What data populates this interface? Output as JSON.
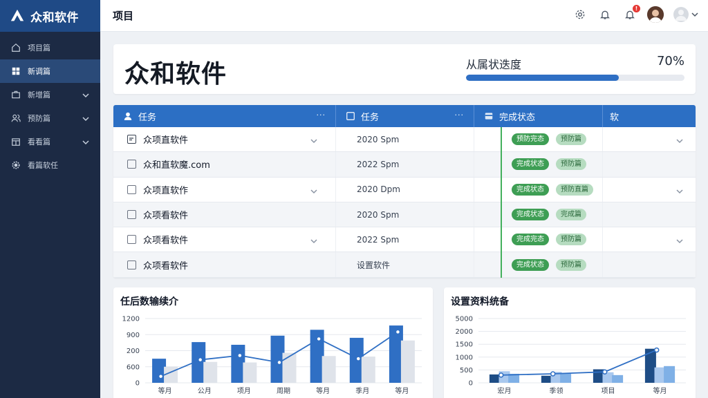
{
  "app": {
    "name": "众和软件"
  },
  "sidebar": {
    "items": [
      {
        "label": "项目篇",
        "icon": "home-icon",
        "active": false,
        "chevron": false
      },
      {
        "label": "新调篇",
        "icon": "grid-icon",
        "active": true,
        "chevron": false
      },
      {
        "label": "新增篇",
        "icon": "briefcase-icon",
        "active": false,
        "chevron": true
      },
      {
        "label": "预防篇",
        "icon": "users-icon",
        "active": false,
        "chevron": true
      },
      {
        "label": "看看篇",
        "icon": "calendar-icon",
        "active": false,
        "chevron": true
      },
      {
        "label": "看篇软任",
        "icon": "gear-icon",
        "active": false,
        "chevron": false
      }
    ]
  },
  "header": {
    "title": "项目",
    "notification_count": "!"
  },
  "hero": {
    "title": "众和软件",
    "progress_label": "从属状迭度",
    "progress_value": "70%",
    "progress_fraction": 0.7,
    "accent": "#2f6fc4"
  },
  "table": {
    "columns": [
      {
        "label": "任务",
        "icon": "user-icon",
        "menu": "···"
      },
      {
        "label": "任务",
        "icon": "checkbox-icon",
        "menu": "···"
      },
      {
        "label": "完成状态",
        "icon": "folder-icon",
        "menu": ""
      },
      {
        "label": "软",
        "icon": "",
        "menu": ""
      }
    ],
    "rows": [
      {
        "name": "众项直软件",
        "checkbox": "doc",
        "date": "2020 Spm",
        "pill_primary": "预防完态",
        "pill_secondary": "预防篇",
        "chevron_name": true,
        "chevron_last": true
      },
      {
        "name": "众和直软魔.com",
        "checkbox": "box",
        "date": "2022 Spm",
        "pill_primary": "完成状态",
        "pill_secondary": "预防篇",
        "chevron_name": false,
        "chevron_last": false
      },
      {
        "name": "众项直软作",
        "checkbox": "box",
        "date": "2020 Dpm",
        "pill_primary": "完成状态",
        "pill_secondary": "预防直篇",
        "chevron_name": true,
        "chevron_last": true
      },
      {
        "name": "众项看软件",
        "checkbox": "box",
        "date": "2020 Spm",
        "pill_primary": "完成状态",
        "pill_secondary": "完成篇",
        "chevron_name": false,
        "chevron_last": false
      },
      {
        "name": "众项看软件",
        "checkbox": "box",
        "date": "2022 Spm",
        "pill_primary": "完成完态",
        "pill_secondary": "预防篇",
        "chevron_name": true,
        "chevron_last": true
      },
      {
        "name": "众项看软件",
        "checkbox": "box",
        "date": "设置软件",
        "pill_primary": "完成状态",
        "pill_secondary": "预防篇",
        "chevron_name": false,
        "chevron_last": false
      }
    ],
    "header_color": "#2c6fc4",
    "status_green": "#3e9e54"
  },
  "chart_data": [
    {
      "type": "bar",
      "title": "任后数输续介",
      "categories": [
        "等月",
        "公月",
        "项月",
        "周期",
        "等月",
        "季月",
        "等月"
      ],
      "yticks": [
        "1200",
        "900",
        "200",
        "600",
        "0"
      ],
      "ylim": [
        0,
        1200
      ],
      "series": [
        {
          "values": [
            450,
            760,
            710,
            880,
            990,
            840,
            1070
          ],
          "color": "#2f6fc4"
        },
        {
          "values": [
            300,
            390,
            380,
            560,
            500,
            490,
            790
          ],
          "color": "#dfe3ea"
        }
      ],
      "line": {
        "values": [
          120,
          430,
          510,
          380,
          820,
          450,
          950
        ],
        "color": "#2f6fc4"
      },
      "grid": true
    },
    {
      "type": "bar",
      "title": "设置资料统备",
      "categories": [
        "宏月",
        "季领",
        "项目",
        "等月"
      ],
      "yticks": [
        "5000",
        "2000",
        "1500",
        "1000",
        "500",
        "0"
      ],
      "ylim": [
        0,
        5000
      ],
      "series": [
        {
          "values": [
            650,
            550,
            1050,
            2650
          ],
          "color": "#1e4d86"
        },
        {
          "values": [
            900,
            850,
            820,
            1200
          ],
          "color": "#a9c8ee"
        },
        {
          "values": [
            700,
            700,
            600,
            1300
          ],
          "color": "#7fb0e6"
        }
      ],
      "line": {
        "values": [
          600,
          700,
          850,
          2550
        ],
        "color": "#2f6fc4"
      },
      "grid": true
    }
  ]
}
